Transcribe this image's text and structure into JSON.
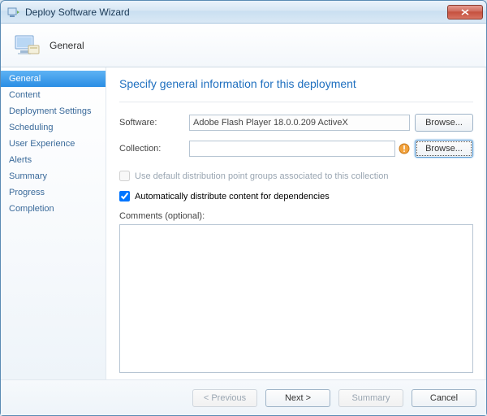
{
  "window": {
    "title": "Deploy Software Wizard"
  },
  "header": {
    "label": "General"
  },
  "sidebar": {
    "items": [
      {
        "label": "General",
        "selected": true
      },
      {
        "label": "Content"
      },
      {
        "label": "Deployment Settings"
      },
      {
        "label": "Scheduling"
      },
      {
        "label": "User Experience"
      },
      {
        "label": "Alerts"
      },
      {
        "label": "Summary"
      },
      {
        "label": "Progress"
      },
      {
        "label": "Completion"
      }
    ]
  },
  "main": {
    "heading": "Specify general information for this deployment",
    "software_label": "Software:",
    "software_value": "Adobe Flash Player 18.0.0.209 ActiveX",
    "collection_label": "Collection:",
    "collection_value": "",
    "browse_label": "Browse...",
    "use_default_groups_label": "Use default distribution point groups associated to this collection",
    "auto_distribute_label": "Automatically distribute content for dependencies",
    "auto_distribute_checked": true,
    "comments_label": "Comments (optional):",
    "comments_value": ""
  },
  "footer": {
    "previous": "< Previous",
    "next": "Next >",
    "summary": "Summary",
    "cancel": "Cancel"
  }
}
